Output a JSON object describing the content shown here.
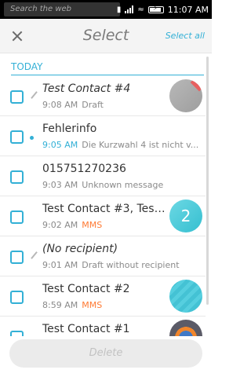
{
  "statusbar": {
    "search_placeholder": "Search the web",
    "time": "11:07 AM"
  },
  "header": {
    "title": "Select",
    "select_all": "Select all"
  },
  "section": "TODAY",
  "messages": [
    {
      "title": "Test Contact #4",
      "time": "9:08 AM",
      "detail": "Draft",
      "mms": false,
      "italic": true,
      "marker": "pencil-icon",
      "avatar": "grey",
      "time_highlight": false
    },
    {
      "title": "Fehlerinfo",
      "time": "9:05 AM",
      "detail": "Die Kurzwahl 4 ist nicht v...",
      "mms": false,
      "italic": false,
      "marker": "unread-dot",
      "avatar": "none",
      "time_highlight": true
    },
    {
      "title": "015751270236",
      "time": "9:03 AM",
      "detail": "Unknown message",
      "mms": false,
      "italic": false,
      "marker": "none",
      "avatar": "none",
      "time_highlight": false
    },
    {
      "title": "Test Contact #3, Test ...",
      "time": "9:02 AM",
      "detail": "MMS",
      "mms": true,
      "italic": false,
      "marker": "none",
      "avatar": "count",
      "avatar_count": "2",
      "time_highlight": false
    },
    {
      "title": "(No recipient)",
      "time": "9:01 AM",
      "detail": "Draft without recipient",
      "mms": false,
      "italic": true,
      "marker": "pencil-icon",
      "avatar": "none",
      "time_highlight": false
    },
    {
      "title": "Test Contact #2",
      "time": "8:59 AM",
      "detail": "MMS",
      "mms": true,
      "italic": false,
      "marker": "none",
      "avatar": "teal",
      "time_highlight": false
    },
    {
      "title": "Test Contact #1",
      "time": "",
      "detail": "",
      "mms": false,
      "italic": false,
      "marker": "none",
      "avatar": "globe",
      "time_highlight": false
    }
  ],
  "footer": {
    "delete_label": "Delete"
  },
  "colors": {
    "accent": "#33b0d6",
    "mms": "#ff7a33"
  }
}
